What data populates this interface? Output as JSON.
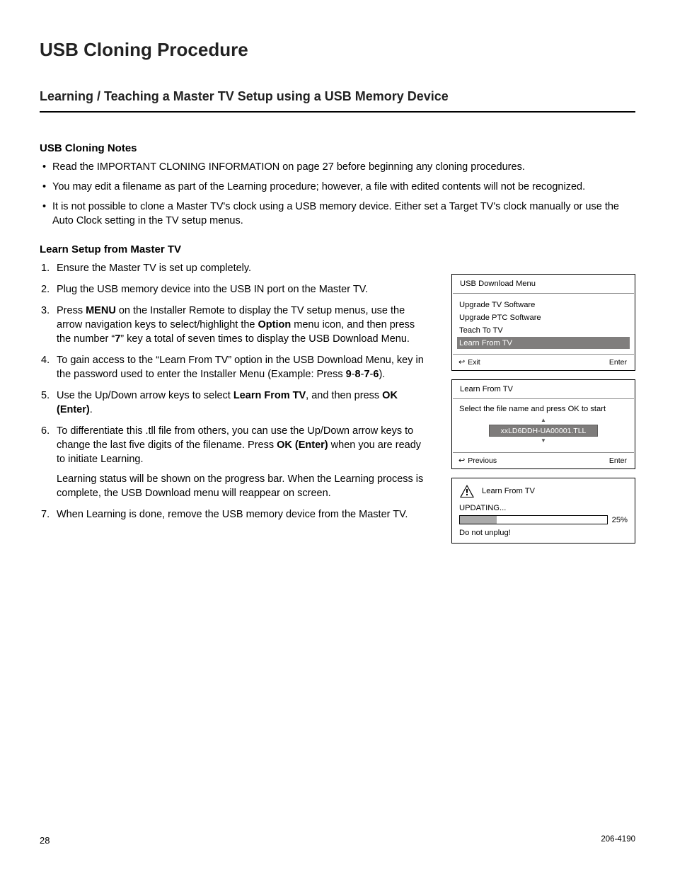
{
  "title": "USB Cloning Procedure",
  "subtitle": "Learning / Teaching a Master TV Setup using a USB Memory Device",
  "notes_heading": "USB Cloning Notes",
  "notes": [
    "Read the IMPORTANT CLONING INFORMATION on page 27 before beginning any cloning procedures.",
    "You may edit a filename as part of the Learning procedure; however, a file with edited contents will not be recognized.",
    "It is not possible to clone a Master TV's clock using a USB memory device. Either set a Target TV's clock manually or use the Auto Clock setting in the TV setup menus."
  ],
  "learn_heading": "Learn Setup from Master TV",
  "steps": [
    {
      "text": "Ensure the Master TV is set up completely."
    },
    {
      "text": "Plug the USB memory device into the USB IN port on the Master TV."
    },
    {
      "pre": "Press ",
      "b1": "MENU",
      "mid1": " on the Installer Remote to display the TV setup menus, use the arrow navigation keys to select/highlight the ",
      "b2": "Option",
      "mid2": " menu icon, and then press the number “",
      "b3": "7",
      "post": "” key a total of seven times to display the USB Download Menu."
    },
    {
      "pre": "To gain access to the “Learn From TV” option in the USB Download Menu, key in the password used to enter the Installer Menu (Example: Press ",
      "b1": "9",
      "dash1": "-",
      "b2": "8",
      "dash2": "-",
      "b3": "7",
      "dash3": "-",
      "b4": "6",
      "post": ")."
    },
    {
      "pre": "Use the Up/Down arrow keys to select ",
      "b1": "Learn From TV",
      "mid1": ", and then press ",
      "b2": "OK (Enter)",
      "post": "."
    },
    {
      "pre": "To differentiate this .tll file from others, you can use the Up/Down arrow keys to change the last five digits of the filename. Press ",
      "b1": "OK (Enter)",
      "post": " when you are ready to initiate Learning.",
      "subpara": "Learning status will be shown on the progress bar. When the Learning process is complete, the USB Download menu will reappear on screen."
    },
    {
      "text": "When Learning is done, remove the USB memory device from the Master TV."
    }
  ],
  "menu1": {
    "header": "USB Download Menu",
    "items": [
      "Upgrade TV Software",
      "Upgrade PTC Software",
      "Teach To TV",
      "Learn From TV"
    ],
    "selected_index": 3,
    "footer_left": "Exit",
    "footer_right": "Enter"
  },
  "menu2": {
    "header": "Learn From TV",
    "prompt": "Select the file name and press OK to start",
    "filename": "xxLD6DDH-UA00001.TLL",
    "footer_left": "Previous",
    "footer_right": "Enter"
  },
  "menu3": {
    "header": "Learn From TV",
    "status": "UPDATING...",
    "percent": "25%",
    "caution": "Do not unplug!"
  },
  "footer": {
    "page_number": "28",
    "doc_id": "206-4190"
  }
}
